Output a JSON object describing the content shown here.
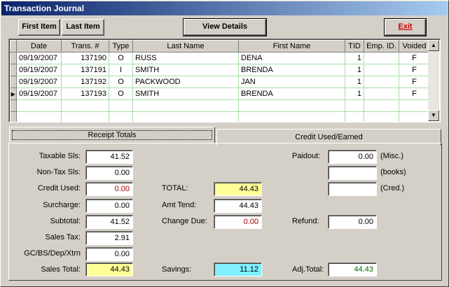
{
  "window": {
    "title": "Transaction Journal"
  },
  "toolbar": {
    "first_item": "First Item",
    "last_item": "Last Item",
    "view_details": "View Details",
    "exit": "Exit"
  },
  "grid": {
    "columns": [
      "Date",
      "Trans. #",
      "Type",
      "Last Name",
      "First Name",
      "TID",
      "Emp. ID.",
      "Voided"
    ],
    "rows": [
      {
        "date": "09/19/2007",
        "trans": "137190",
        "type": "O",
        "last": "RUSS",
        "first": "DENA",
        "tid": "1",
        "emp": "",
        "voided": "F"
      },
      {
        "date": "09/19/2007",
        "trans": "137191",
        "type": "I",
        "last": "SMITH",
        "first": "BRENDA",
        "tid": "1",
        "emp": "",
        "voided": "F"
      },
      {
        "date": "09/19/2007",
        "trans": "137192",
        "type": "O",
        "last": "PACKWOOD",
        "first": "JAN",
        "tid": "1",
        "emp": "",
        "voided": "F"
      },
      {
        "date": "09/19/2007",
        "trans": "137193",
        "type": "O",
        "last": "SMITH",
        "first": "BRENDA",
        "tid": "1",
        "emp": "",
        "voided": "F"
      }
    ],
    "current_row": 3
  },
  "tabs": {
    "receipt_totals": "Receipt Totals",
    "credit_used_earned": "Credit Used/Earned"
  },
  "totals": {
    "taxable_label": "Taxable Sls:",
    "taxable": "41.52",
    "nontax_label": "Non-Tax Sls:",
    "nontax": "0.00",
    "credit_used_label": "Credit Used:",
    "credit_used": "0.00",
    "surcharge_label": "Surcharge:",
    "surcharge": "0.00",
    "subtotal_label": "Subtotal:",
    "subtotal": "41.52",
    "sales_tax_label": "Sales Tax:",
    "sales_tax": "2.91",
    "gc_label": "GC/BS/Dep/Xtrn",
    "gc": "0.00",
    "sales_total_label": "Sales Total:",
    "sales_total": "44.43",
    "total_label": "TOTAL:",
    "total": "44.43",
    "amt_tend_label": "Amt Tend:",
    "amt_tend": "44.43",
    "change_due_label": "Change Due:",
    "change_due": "0.00",
    "savings_label": "Savings:",
    "savings": "11.12",
    "paidout_label": "Paidout:",
    "paidout": "0.00",
    "misc_label": "(Misc.)",
    "books_label": "(books)",
    "books": "",
    "cred_label": "(Cred.)",
    "cred": "",
    "refund_label": "Refund:",
    "refund": "0.00",
    "adj_total_label": "Adj.Total:",
    "adj_total": "44.43"
  },
  "icons": {
    "row_indicator": "triangle-right-icon",
    "scroll_up": "arrow-up-icon",
    "scroll_down": "arrow-down-icon"
  },
  "colors": {
    "title_start": "#0a246a",
    "title_end": "#a6caf0",
    "grid_line": "#a8dca8",
    "total_highlight": "#ffff99",
    "savings_highlight": "#80f0ff"
  }
}
